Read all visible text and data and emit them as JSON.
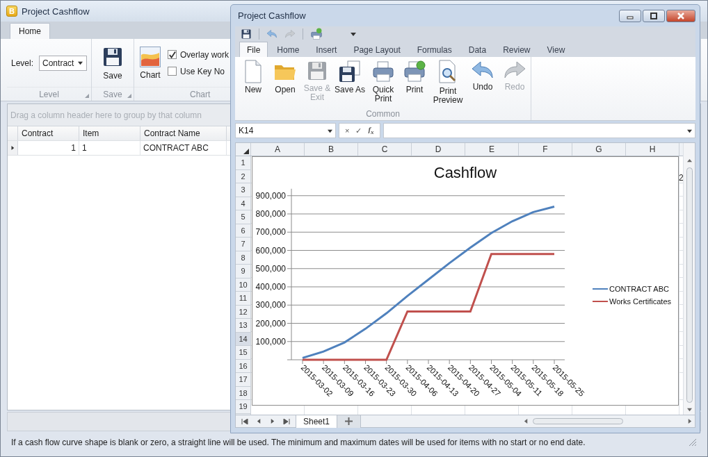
{
  "main_window": {
    "app_icon": "B",
    "title": "Project Cashflow",
    "tabs": [
      {
        "label": "Home",
        "selected": true
      }
    ],
    "level_group": {
      "label": "Level:",
      "value": "Contract",
      "caption": "Level"
    },
    "save_group": {
      "button": "Save",
      "caption": "Save"
    },
    "chart_group": {
      "button": "Chart",
      "caption": "Chart",
      "options": [
        {
          "label": "Overlay work",
          "checked": true
        },
        {
          "label": "Use Key No",
          "checked": false
        }
      ]
    },
    "group_panel": "Drag a column header here to group by that column",
    "grid": {
      "columns": [
        "Contract",
        "Item",
        "Contract Name"
      ],
      "rows": [
        {
          "selected": true,
          "cells": [
            "1",
            "1",
            "CONTRACT ABC"
          ]
        }
      ]
    },
    "status_bar": "If a cash flow curve shape is blank or zero, a straight line will be used. The minimum and maximum dates will be used for items with no start or no end date."
  },
  "sheet_window": {
    "title": "Project Cashflow",
    "tabs": [
      {
        "label": "File",
        "selected": true
      },
      {
        "label": "Home",
        "selected": false
      },
      {
        "label": "Insert",
        "selected": false
      },
      {
        "label": "Page Layout",
        "selected": false
      },
      {
        "label": "Formulas",
        "selected": false
      },
      {
        "label": "Data",
        "selected": false
      },
      {
        "label": "Review",
        "selected": false
      },
      {
        "label": "View",
        "selected": false
      }
    ],
    "ribbon": {
      "buttons": [
        {
          "label": "New",
          "disabled": false
        },
        {
          "label": "Open",
          "disabled": false
        },
        {
          "label": "Save & Exit",
          "disabled": true
        },
        {
          "label": "Save As",
          "disabled": false
        },
        {
          "label": "Quick Print",
          "disabled": false
        },
        {
          "label": "Print",
          "disabled": false
        },
        {
          "label": "Print Preview",
          "disabled": false
        },
        {
          "label": "Undo",
          "disabled": false
        },
        {
          "label": "Redo",
          "disabled": true
        }
      ],
      "group": "Common"
    },
    "name_box": "K14",
    "formula_buttons": [
      "×",
      "✓",
      "f$_{x}$"
    ],
    "columns": [
      "A",
      "B",
      "C",
      "D",
      "E",
      "F",
      "G",
      "H"
    ],
    "rows": [
      {
        "label": "1",
        "selected": false
      },
      {
        "label": "2",
        "selected": false
      },
      {
        "label": "3",
        "selected": false
      },
      {
        "label": "4",
        "selected": false
      },
      {
        "label": "5",
        "selected": false
      },
      {
        "label": "6",
        "selected": false
      },
      {
        "label": "7",
        "selected": false
      },
      {
        "label": "8",
        "selected": false
      },
      {
        "label": "9",
        "selected": false
      },
      {
        "label": "10",
        "selected": false
      },
      {
        "label": "11",
        "selected": false
      },
      {
        "label": "12",
        "selected": false
      },
      {
        "label": "13",
        "selected": false
      },
      {
        "label": "14",
        "selected": true
      },
      {
        "label": "15",
        "selected": false
      },
      {
        "label": "16",
        "selected": false
      },
      {
        "label": "17",
        "selected": false
      },
      {
        "label": "18",
        "selected": false
      },
      {
        "label": "19",
        "selected": false
      }
    ],
    "cell_text": "2",
    "chart": {
      "chart_data": {
        "type": "line",
        "title": "Cashflow",
        "categories": [
          "2015-03-02",
          "2015-03-09",
          "2015-03-16",
          "2015-03-23",
          "2015-03-30",
          "2015-04-06",
          "2015-04-13",
          "2015-04-20",
          "2015-04-27",
          "2015-05-04",
          "2015-05-11",
          "2015-05-18",
          "2015-05-25"
        ],
        "series": [
          {
            "name": "CONTRACT ABC",
            "color": "#4f81bd",
            "values": [
              10000,
              45000,
              95000,
              170000,
              255000,
              350000,
              440000,
              530000,
              615000,
              695000,
              760000,
              810000,
              840000
            ]
          },
          {
            "name": "Works Certificates",
            "color": "#c0504d",
            "values": [
              0,
              0,
              0,
              0,
              0,
              265000,
              265000,
              265000,
              265000,
              580000,
              580000,
              580000,
              580000
            ]
          }
        ],
        "ylim": [
          0,
          900000
        ],
        "grid": true,
        "legend": true,
        "yticks": [
          {
            "value": 100000,
            "label": "100,000"
          },
          {
            "value": 200000,
            "label": "200,000"
          },
          {
            "value": 300000,
            "label": "300,000"
          },
          {
            "value": 400000,
            "label": "400,000"
          },
          {
            "value": 500000,
            "label": "500,000"
          },
          {
            "value": 600000,
            "label": "600,000"
          },
          {
            "value": 700000,
            "label": "700,000"
          },
          {
            "value": 800000,
            "label": "800,000"
          },
          {
            "value": 900000,
            "label": "900,000"
          }
        ]
      }
    },
    "sheet_tabs": [
      {
        "label": "Sheet1",
        "selected": true
      }
    ]
  }
}
